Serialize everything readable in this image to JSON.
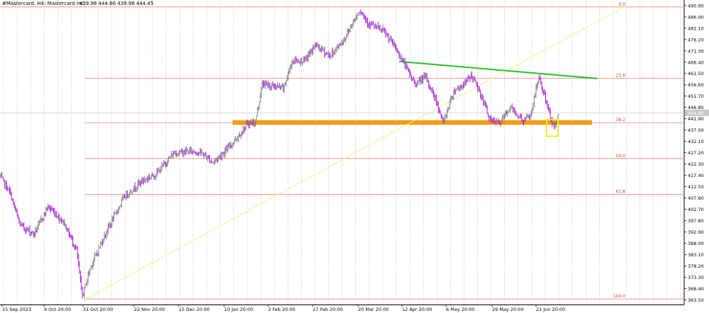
{
  "header": {
    "symbol": "#Mastercard, H4:  Mastercard Inc.",
    "ohlc": "439.98 444.66 439.98 444.45"
  },
  "chart_data": {
    "type": "candlestick",
    "ylim": [
      361.5,
      493.3
    ],
    "y_ticks": [
      "490.90",
      "486.00",
      "481.10",
      "476.20",
      "471.30",
      "466.40",
      "461.50",
      "456.60",
      "451.70",
      "446.80",
      "441.90",
      "437.00",
      "432.10",
      "427.20",
      "422.30",
      "417.40",
      "412.50",
      "407.60",
      "402.70",
      "397.80",
      "392.90",
      "388.00",
      "383.10",
      "378.20",
      "373.30",
      "368.40",
      "363.50"
    ],
    "current_price": "444.45",
    "x_labels": [
      "15 Sep 2023",
      "9 Oct 20:00",
      "31 Oct 20:00",
      "22 Nov 20:00",
      "15 Dec 20:00",
      "10 Jan 20:00",
      "2 Feb 20:00",
      "27 Feb 20:00",
      "20 Mar 20:00",
      "12 Apr 20:00",
      "6 May 20:00",
      "29 May 20:00",
      "21 Jun 20:00"
    ],
    "path": [
      [
        0,
        417
      ],
      [
        14,
        410
      ],
      [
        28,
        396
      ],
      [
        48,
        392
      ],
      [
        68,
        404
      ],
      [
        90,
        397
      ],
      [
        108,
        385
      ],
      [
        116,
        365
      ],
      [
        128,
        378
      ],
      [
        150,
        393
      ],
      [
        175,
        408
      ],
      [
        200,
        415
      ],
      [
        220,
        418
      ],
      [
        245,
        427
      ],
      [
        270,
        428
      ],
      [
        285,
        427
      ],
      [
        300,
        423
      ],
      [
        318,
        428
      ],
      [
        335,
        434
      ],
      [
        350,
        440
      ],
      [
        360,
        440
      ],
      [
        370,
        457
      ],
      [
        385,
        456
      ],
      [
        400,
        455
      ],
      [
        412,
        467
      ],
      [
        430,
        467
      ],
      [
        445,
        474
      ],
      [
        465,
        469
      ],
      [
        485,
        476
      ],
      [
        500,
        485
      ],
      [
        508,
        489
      ],
      [
        520,
        483
      ],
      [
        540,
        480
      ],
      [
        555,
        474
      ],
      [
        568,
        467
      ],
      [
        585,
        457
      ],
      [
        600,
        460
      ],
      [
        615,
        450
      ],
      [
        625,
        440
      ],
      [
        640,
        454
      ],
      [
        655,
        457
      ],
      [
        665,
        461
      ],
      [
        680,
        451
      ],
      [
        692,
        441
      ],
      [
        705,
        440
      ],
      [
        720,
        447
      ],
      [
        738,
        441
      ],
      [
        748,
        443
      ],
      [
        760,
        460
      ],
      [
        768,
        452
      ],
      [
        775,
        444
      ],
      [
        782,
        438
      ],
      [
        788,
        444
      ]
    ],
    "candle_colors": {
      "up": "#7d7d7d",
      "down": "#aa19e6"
    },
    "fibonacci": [
      {
        "label": "0.0",
        "value": 490.3
      },
      {
        "label": "23.6",
        "value": 459.4
      },
      {
        "label": "38.2",
        "value": 440.2
      },
      {
        "label": "50.0",
        "value": 424.7
      },
      {
        "label": "61.8",
        "value": 409.1
      },
      {
        "label": "100.0",
        "value": 363.9
      }
    ],
    "fib_color": "#f08080",
    "support_zone": {
      "from": 439.3,
      "to": 441.3,
      "color": "#f39c12"
    },
    "trendline_green": {
      "p1": [
        563,
        466.7
      ],
      "p2": [
        843,
        459.3
      ],
      "color": "#27c227"
    },
    "trendline_yellow": {
      "p1": [
        118,
        363.5
      ],
      "p2": [
        884,
        490.9
      ],
      "color": "#f5ef8a"
    },
    "highlight_box": {
      "x": [
        771,
        787
      ],
      "y": [
        434.3,
        441.5
      ],
      "color": "#f2ea2f"
    }
  }
}
